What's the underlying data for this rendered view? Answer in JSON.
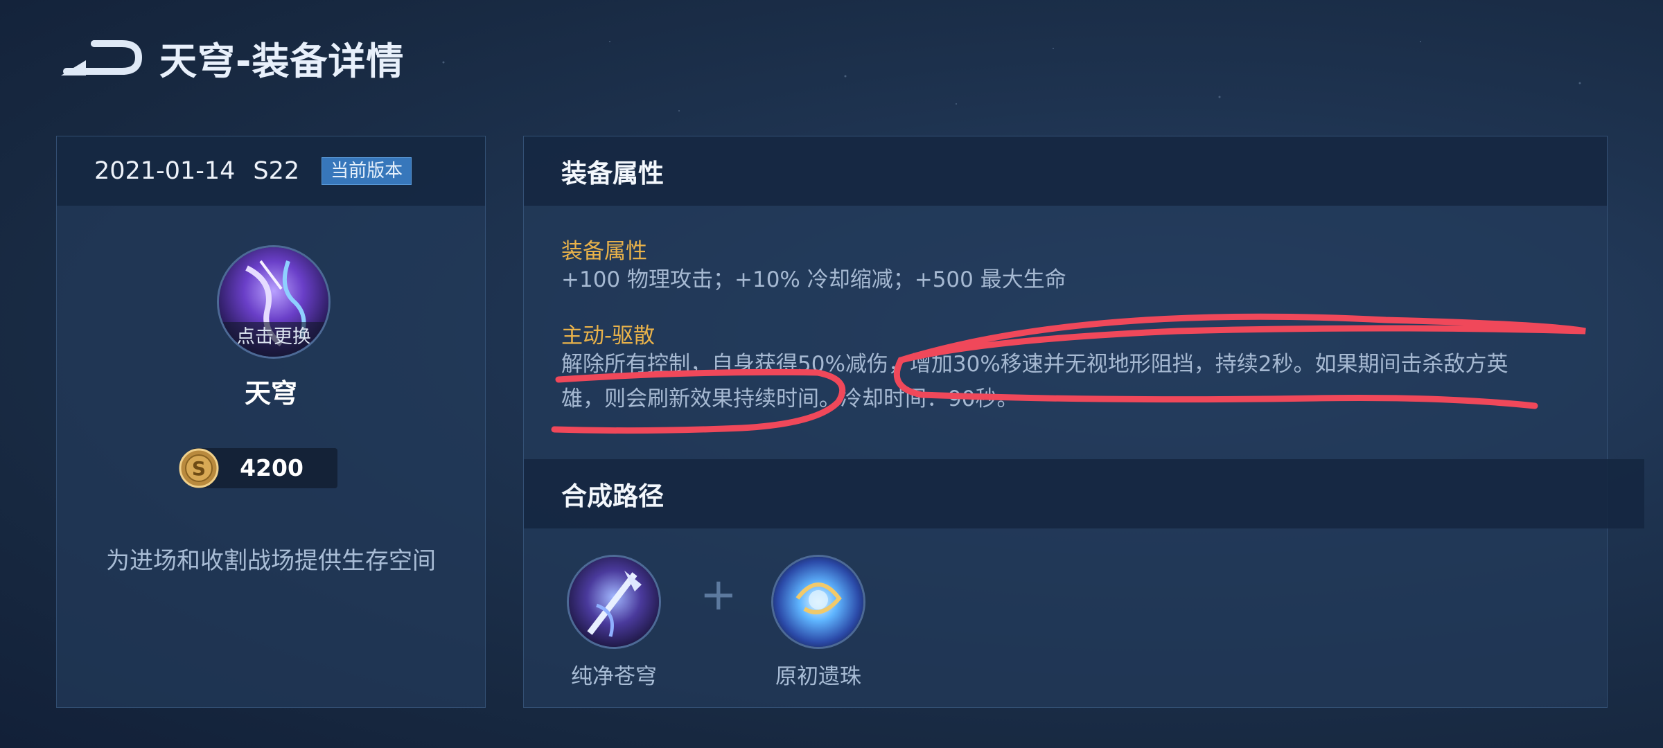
{
  "header": {
    "back_icon": "back-arrow-icon",
    "title": "天穹-装备详情"
  },
  "left_panel": {
    "date": "2021-01-14",
    "season": "S22",
    "version_badge": "当前版本",
    "avatar_action": "点击更换",
    "item_name": "天穹",
    "coin_icon": "gold-coin-icon",
    "price": "4200",
    "description": "为进场和收割战场提供生存空间"
  },
  "right_panel": {
    "attributes_header": "装备属性",
    "attributes_label": "装备属性",
    "attributes_text": "+100 物理攻击；+10% 冷却缩减；+500 最大生命",
    "active_label": "主动-驱散",
    "active_text": "解除所有控制，自身获得50%减伤，增加30%移速并无视地形阻挡，持续2秒。如果期间击杀敌方英雄，则会刷新效果持续时间。冷却时间：90秒。",
    "recipe_header": "合成路径",
    "components": [
      {
        "name": "纯净苍穹",
        "icon": "pure-sky-icon"
      },
      {
        "name": "原初遗珠",
        "icon": "primordial-pearl-icon"
      }
    ],
    "plus": "+"
  },
  "colors": {
    "accent_gold": "#e9b24a",
    "annotation_red": "#f0485a",
    "badge_blue": "#3777bb"
  }
}
